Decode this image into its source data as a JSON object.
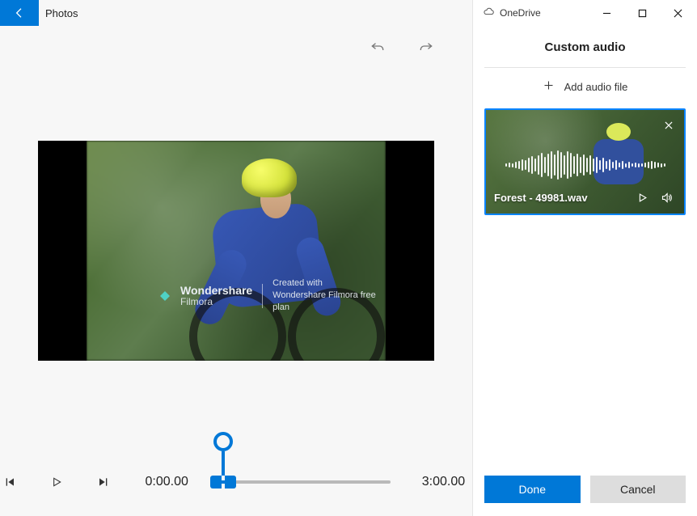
{
  "app": {
    "title": "Photos"
  },
  "onedrive_label": "OneDrive",
  "panel": {
    "title": "Custom audio",
    "add_label": "Add audio file",
    "done_label": "Done",
    "cancel_label": "Cancel"
  },
  "audio_card": {
    "filename": "Forest - 49981.wav"
  },
  "watermark": {
    "brand_line1": "Wondershare",
    "brand_line2": "Filmora",
    "created_with": "Created with",
    "subline": "Wondershare Filmora free plan"
  },
  "timeline": {
    "current": "0:00.00",
    "total": "3:00.00"
  }
}
